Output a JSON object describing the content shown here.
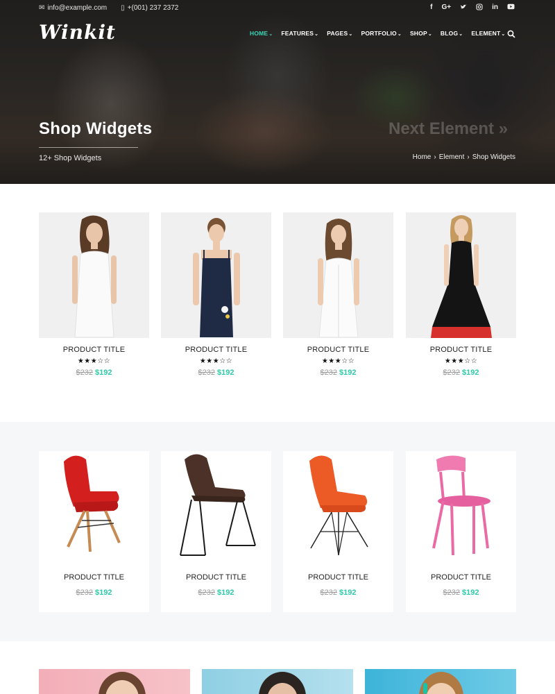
{
  "topbar": {
    "email": "info@example.com",
    "phone": "+(001) 237 2372",
    "social": [
      "f",
      "G+",
      "t",
      "ig",
      "in",
      "yt"
    ]
  },
  "brand": {
    "logo": "Winkit"
  },
  "nav": {
    "items": [
      {
        "label": "HOME"
      },
      {
        "label": "FEATURES"
      },
      {
        "label": "PAGES"
      },
      {
        "label": "PORTFOLIO"
      },
      {
        "label": "SHOP"
      },
      {
        "label": "BLOG"
      },
      {
        "label": "ELEMENT"
      }
    ],
    "active": "HOME"
  },
  "hero": {
    "title": "Shop Widgets",
    "subtitle": "12+ Shop Widgets",
    "next_link": "Next Element »",
    "breadcrumb": [
      "Home",
      "Element",
      "Shop Widgets"
    ]
  },
  "products": [
    {
      "title": "PRODUCT TITLE",
      "rating": "★★★☆☆",
      "old_price": "$232",
      "price": "$192",
      "image": "white-dress"
    },
    {
      "title": "PRODUCT TITLE",
      "rating": "★★★☆☆",
      "old_price": "$232",
      "price": "$192",
      "image": "navy-jumpsuit"
    },
    {
      "title": "PRODUCT TITLE",
      "rating": "★★★☆☆",
      "old_price": "$232",
      "price": "$192",
      "image": "white-sundress"
    },
    {
      "title": "PRODUCT TITLE",
      "rating": "★★★☆☆",
      "old_price": "$232",
      "price": "$192",
      "image": "black-dress"
    }
  ],
  "chairs": [
    {
      "title": "PRODUCT TITLE",
      "old_price": "$232",
      "price": "$192",
      "image": "red-chair"
    },
    {
      "title": "PRODUCT TITLE",
      "old_price": "$232",
      "price": "$192",
      "image": "brown-chair"
    },
    {
      "title": "PRODUCT TITLE",
      "old_price": "$232",
      "price": "$192",
      "image": "orange-chair"
    },
    {
      "title": "PRODUCT TITLE",
      "old_price": "$232",
      "price": "$192",
      "image": "pink-chair"
    }
  ],
  "colors": {
    "accent": "#2bc9a7",
    "active_nav": "#3ad6b6",
    "section_bg": "#f5f7f9"
  }
}
